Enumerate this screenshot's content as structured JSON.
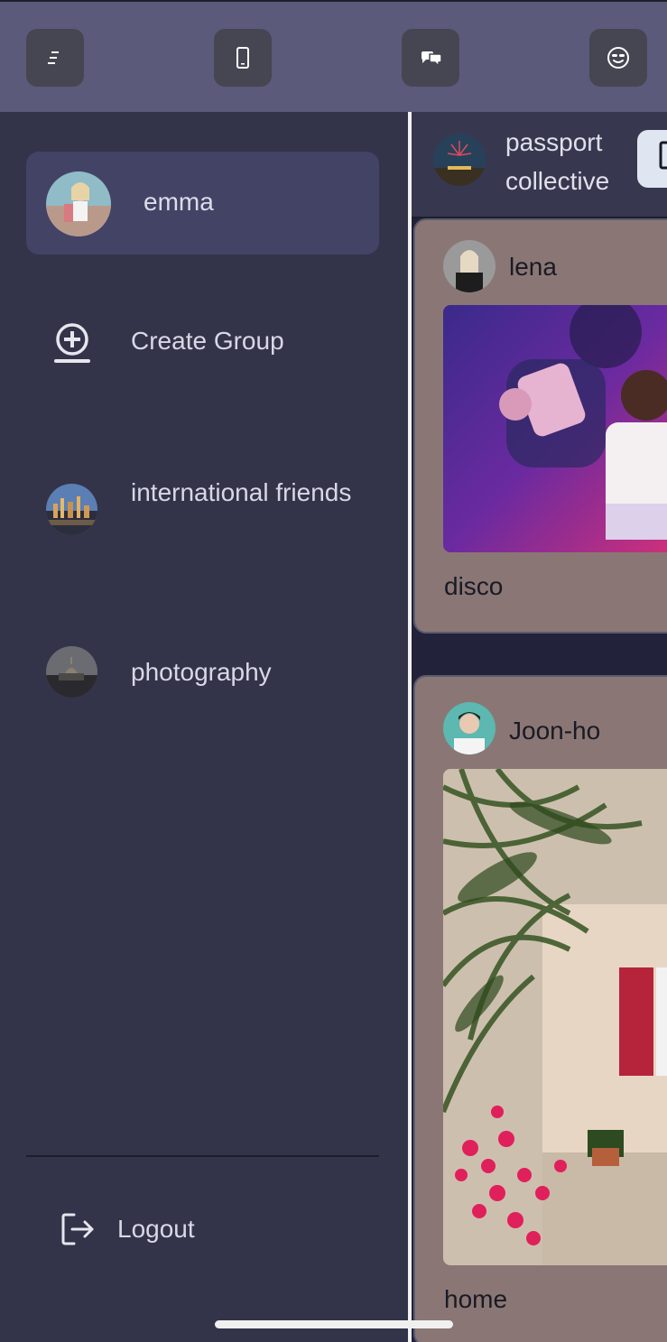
{
  "topbar": {
    "buttons": [
      {
        "icon": "menu-icon"
      },
      {
        "icon": "phone-icon"
      },
      {
        "icon": "chat-bubbles-icon"
      },
      {
        "icon": "smiley-icon"
      }
    ]
  },
  "drawer": {
    "profile": {
      "name": "emma"
    },
    "create_group_label": "Create Group",
    "groups": [
      {
        "name": "international friends"
      },
      {
        "name": "photography"
      }
    ],
    "logout_label": "Logout"
  },
  "feed": {
    "group": {
      "name": "passport collective"
    },
    "posts": [
      {
        "user": "lena",
        "caption": "disco"
      },
      {
        "user": "Joon-ho",
        "caption": "home"
      }
    ]
  },
  "colors": {
    "topbar": "#5b5a7a",
    "drawer": "#333449",
    "active_card": "#434366",
    "post_card": "#8a7775"
  }
}
